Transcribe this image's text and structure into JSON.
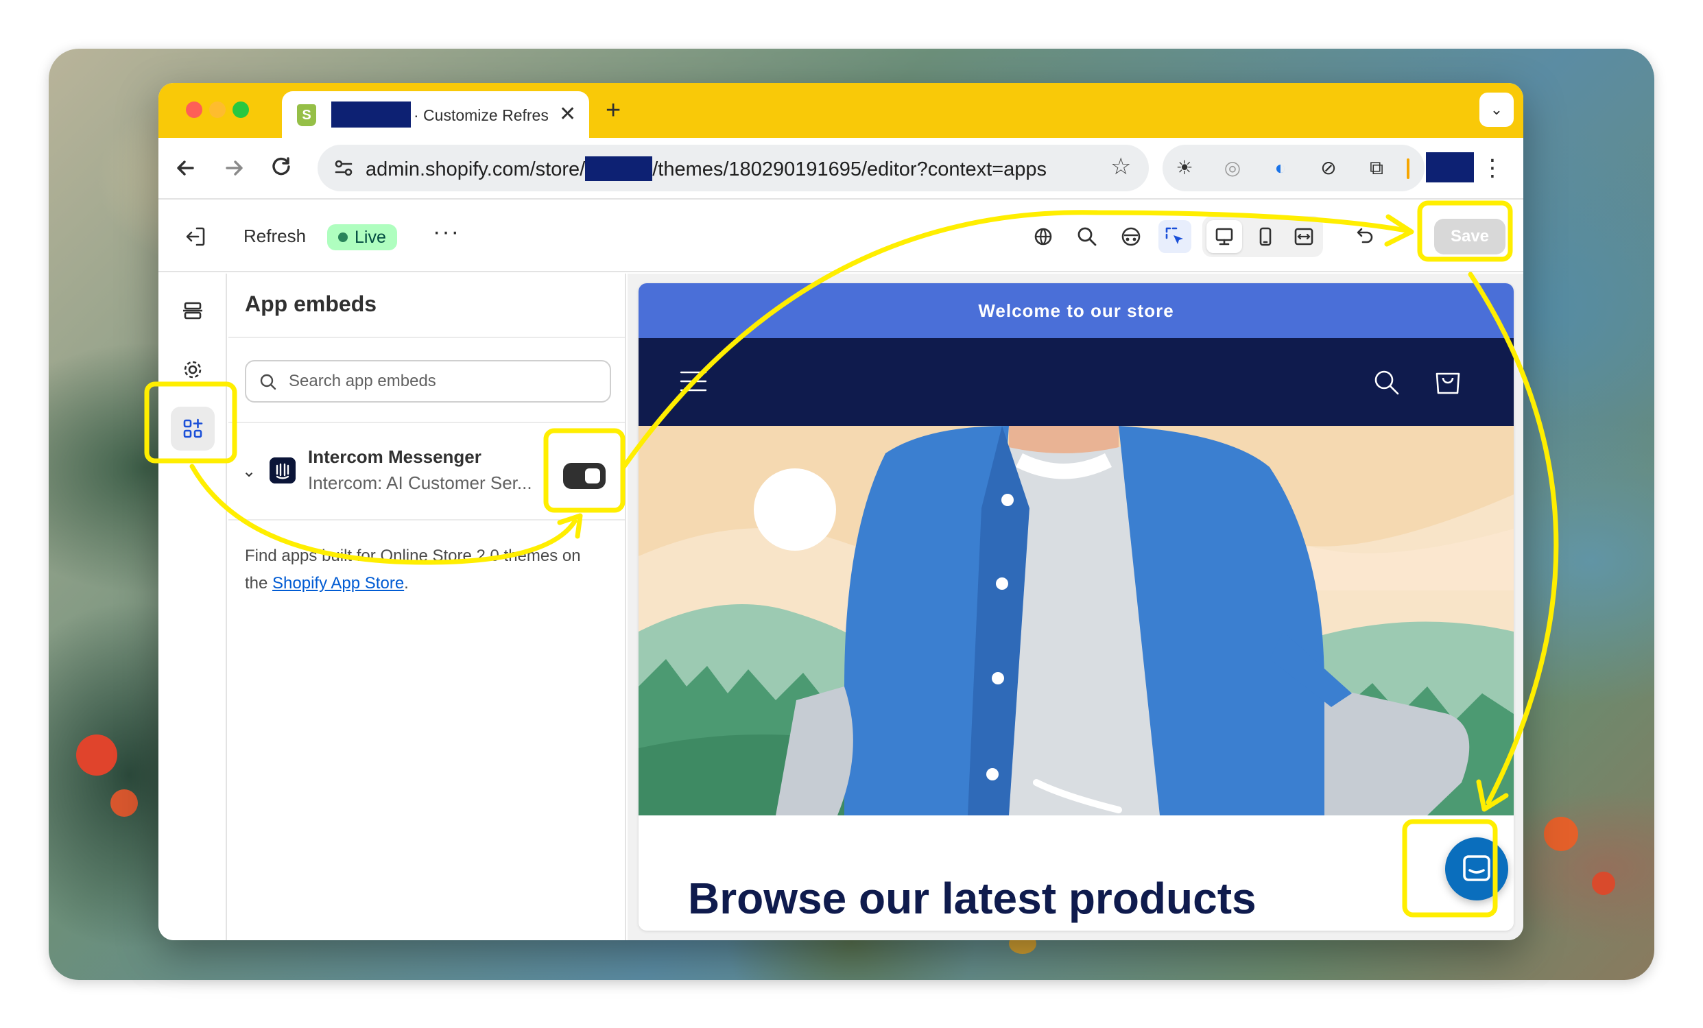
{
  "browser": {
    "tab_title": "· Customize Refres",
    "tab_close": "✕",
    "new_tab": "+",
    "tab_menu": "⌄",
    "url_prefix": "admin.shopify.com/store/",
    "url_suffix": "/themes/180290191695/editor?context=apps",
    "kebab": "⋮"
  },
  "editor": {
    "theme_name": "Refresh",
    "status_badge": "Live",
    "more": "···",
    "save_label": "Save"
  },
  "panel": {
    "title": "App embeds",
    "search_placeholder": "Search app embeds",
    "embed": {
      "name": "Intercom Messenger",
      "subtitle": "Intercom: AI Customer Ser...",
      "enabled": true
    },
    "help_prefix": "Find apps built for Online Store 2.0 themes on the ",
    "help_link": "Shopify App Store",
    "help_suffix": "."
  },
  "preview": {
    "announcement": "Welcome to our store",
    "section_heading": "Browse our latest products"
  },
  "colors": {
    "tabstrip": "#f9c908",
    "annotation": "#ffee00",
    "announcement_bar": "#4a6fd8",
    "store_header": "#0f1b4d",
    "chat_launcher": "#0a6ebd"
  },
  "icons": [
    "exit-icon",
    "globe-icon",
    "search-icon",
    "palette-icon",
    "select-icon",
    "desktop-icon",
    "mobile-icon",
    "fullwidth-icon",
    "undo-icon",
    "sections-icon",
    "gear-icon",
    "apps-icon",
    "cart-icon",
    "chat-icon"
  ]
}
